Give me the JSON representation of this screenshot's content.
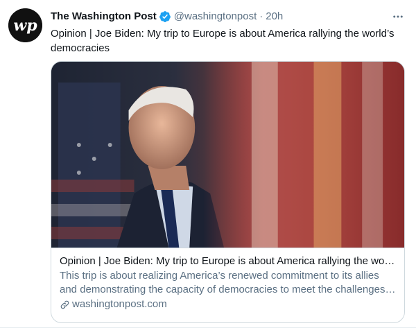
{
  "author": {
    "name": "The Washington Post",
    "handle": "@washingtonpost",
    "separator": "·",
    "time": "20h",
    "avatar_icon": "washington-post-logo",
    "verified_icon": "verified-badge-icon",
    "verified_color": "#1da1f2"
  },
  "tweet": {
    "text": "Opinion | Joe Biden: My trip to Europe is about America rallying the world’s\ndemocracies"
  },
  "card": {
    "image_icon": "article-photo",
    "title": "Opinion | Joe Biden: My trip to Europe is about America rallying the world’s democracies",
    "description": "This trip is about realizing America’s renewed commitment to its allies and demonstrating the capacity of democracies to meet the challenges of this new age.",
    "domain": "washingtonpost.com",
    "link_icon": "link-icon"
  },
  "colors": {
    "text_primary": "#0f1419",
    "text_secondary": "#5b7083",
    "border": "#cfd9de"
  }
}
